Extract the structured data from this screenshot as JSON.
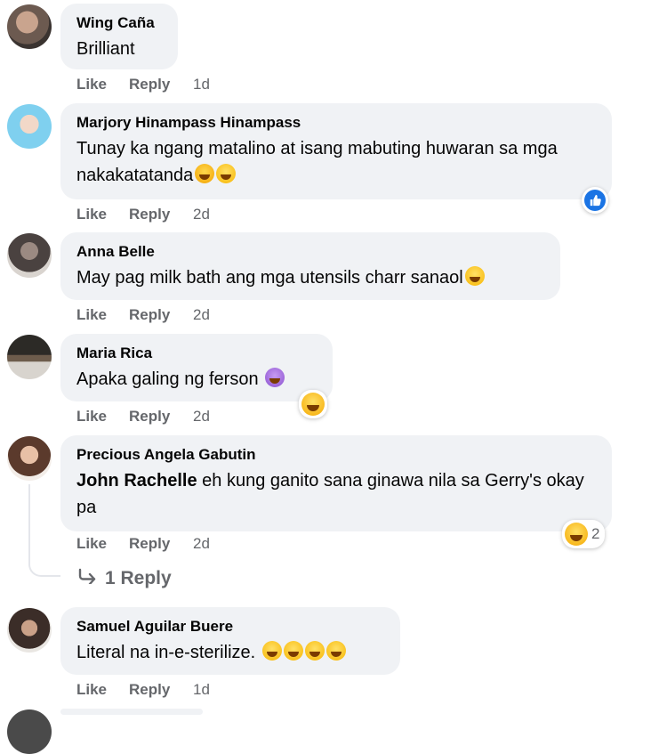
{
  "comments": [
    {
      "author": "Wing Caña",
      "text": "Brilliant",
      "like": "Like",
      "reply": "Reply",
      "time": "1d"
    },
    {
      "author": "Marjory Hinampass Hinampass",
      "text": "Tunay ka ngang matalino at isang mabuting huwaran sa mga nakakatatanda",
      "like": "Like",
      "reply": "Reply",
      "time": "2d"
    },
    {
      "author": "Anna Belle",
      "text": "May pag milk bath ang mga utensils charr sanaol",
      "like": "Like",
      "reply": "Reply",
      "time": "2d"
    },
    {
      "author": "Maria Rica",
      "text": "Apaka galing ng ferson",
      "like": "Like",
      "reply": "Reply",
      "time": "2d"
    },
    {
      "author": "Precious Angela Gabutin",
      "tag": "John Rachelle",
      "text": " eh kung ganito sana ginawa nila sa Gerry's okay pa",
      "like": "Like",
      "reply": "Reply",
      "time": "2d",
      "reaction_count": "2"
    },
    {
      "author": "Samuel Aguilar Buere",
      "text": "Literal na in-e-sterilize.",
      "like": "Like",
      "reply": "Reply",
      "time": "1d"
    }
  ],
  "view_replies": "1 Reply",
  "icons": {
    "like_reaction": "thumbs-up-icon",
    "haha_reaction": "laughing-emoji-icon",
    "reply_arrow": "reply-arrow-icon"
  },
  "colors": {
    "bubble": "#f0f2f5",
    "meta": "#65676b",
    "like_blue": "#1b74e4"
  }
}
